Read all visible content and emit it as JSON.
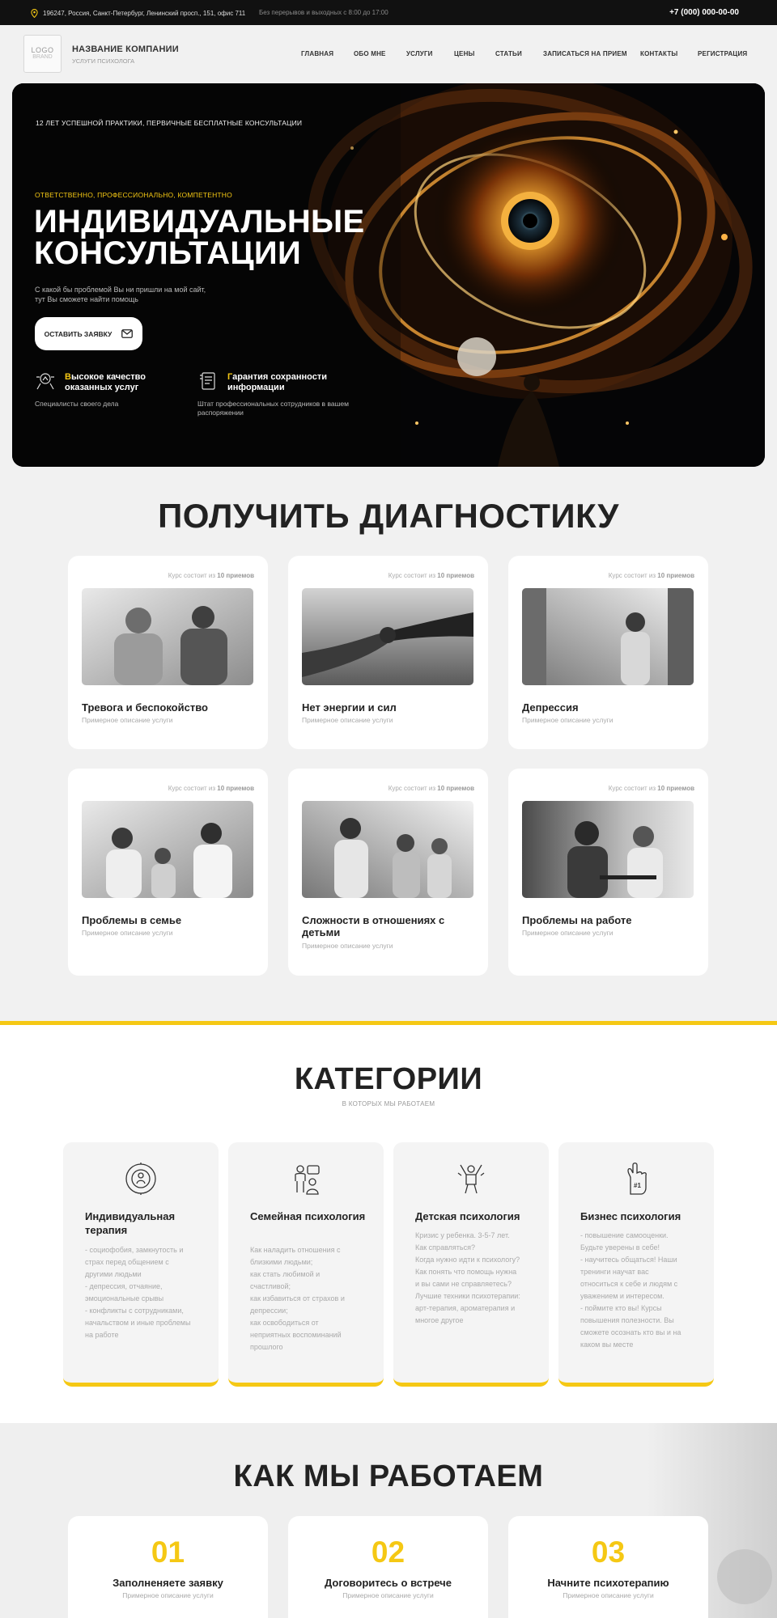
{
  "topbar": {
    "address": "196247, Россия, Санкт-Петербург, Ленинский просп., 151, офис 711",
    "hours": "Без перерывов и выходных с 8:00 до 17:00",
    "phone": "+7 (000) 000-00-00"
  },
  "header": {
    "logo_line1": "LOGO",
    "logo_line2": "BRAND",
    "company_name": "НАЗВАНИЕ КОМПАНИИ",
    "company_sub": "УСЛУГИ ПСИХОЛОГА",
    "nav": [
      "ГЛАВНАЯ",
      "ОБО МНЕ",
      "УСЛУГИ",
      "ЦЕНЫ",
      "СТАТЬИ",
      "ЗАПИСАТЬСЯ НА ПРИЕМ",
      "КОНТАКТЫ",
      "РЕГИСТРАЦИЯ"
    ]
  },
  "hero": {
    "badge": "12 ЛЕТ УСПЕШНОЙ ПРАКТИКИ, ПЕРВИЧНЫЕ БЕСПЛАТНЫЕ КОНСУЛЬТАЦИИ",
    "eyebrow": "ОТВЕТСТВЕННО, ПРОФЕССИОНАЛЬНО, КОМПЕТЕНТНО",
    "title_line1": "ИНДИВИДУАЛЬНЫЕ",
    "title_line2": "КОНСУЛЬТАЦИИ",
    "lead": "С какой бы проблемой Вы ни пришли на мой сайт, тут Вы сможете найти помощь",
    "cta": "ОСТАВИТЬ ЗАЯВКУ",
    "features": [
      {
        "first": "В",
        "title": "ысокое качество оказанных услуг",
        "desc": "Специалисты своего дела",
        "icon": "quality-icon"
      },
      {
        "first": "Г",
        "title": "арантия сохранности информации",
        "desc": "Штат профессиональных сотрудников в вашем распоряжении",
        "icon": "document-icon"
      }
    ]
  },
  "diagnostics": {
    "title": "ПОЛУЧИТЬ ДИАГНОСТИКУ",
    "course_prefix": "Курс состоит из",
    "course_count": "10 приемов",
    "cards": [
      {
        "title": "Тревога и беспокойство",
        "desc": "Примерное описание услуги"
      },
      {
        "title": "Нет энергии и сил",
        "desc": "Примерное описание услуги"
      },
      {
        "title": "Депрессия",
        "desc": "Примерное описание услуги"
      },
      {
        "title": "Проблемы в семье",
        "desc": "Примерное описание услуги"
      },
      {
        "title": "Сложности в отношениях с детьми",
        "desc": "Примерное описание услуги"
      },
      {
        "title": "Проблемы на работе",
        "desc": "Примерное описание услуги"
      }
    ]
  },
  "categories": {
    "title": "КАТЕГОРИИ",
    "subtitle": "В КОТОРЫХ МЫ РАБОТАЕМ",
    "items": [
      {
        "icon": "person-circle-icon",
        "title": "Индивидуальная терапия",
        "desc": "- социофобия, замкнутость и\nстрах перед общением с\nдругими людьми\n- депрессия, отчаяние,\nэмоциональные срывы\n- конфликты с сотрудниками,\nначальством и иные проблемы\nна работе"
      },
      {
        "icon": "family-icon",
        "title": "Семейная психология",
        "desc": "Как наладить отношения с\nблизкими людьми;\nкак стать любимой и\nсчастливой;\nкак избавиться от страхов и\nдепрессии;\nкак освободиться от\nнеприятных воспоминаний\nпрошлого"
      },
      {
        "icon": "child-icon",
        "title": "Детская психология",
        "desc": "Кризис у ребенка. 3-5-7 лет.\nКак справляться?\nКогда нужно идти к психологу?\nКак понять что помощь нужна\nи вы сами не справляетесь?\nЛучшие техники психотерапии:\nарт-терапия, ароматерапия и\nмногое другое"
      },
      {
        "icon": "foam-hand-icon",
        "title": "Бизнес психология",
        "desc": "- повышение самооценки.\nБудьте уверены в себе!\n- научитесь общаться! Наши\nтренинги научат вас\nотноситься к себе и людям с\nуважением и интересом.\n- поймите кто вы! Курсы\nповышения полезности. Вы\nсможете осознать кто вы и на\nкаком вы месте"
      }
    ]
  },
  "how": {
    "title": "КАК МЫ РАБОТАЕМ",
    "steps": [
      {
        "num": "01",
        "title": "Заполненяете заявку",
        "desc": "Примерное описание услуги"
      },
      {
        "num": "02",
        "title": "Договоритесь о встрече",
        "desc": "Примерное описание услуги"
      },
      {
        "num": "03",
        "title": "Начните психотерапию",
        "desc": "Примерное описание услуги"
      }
    ]
  },
  "colors": {
    "accent": "#f5c814",
    "dark": "#111111",
    "card": "#ffffff",
    "page": "#f1f1f1"
  }
}
